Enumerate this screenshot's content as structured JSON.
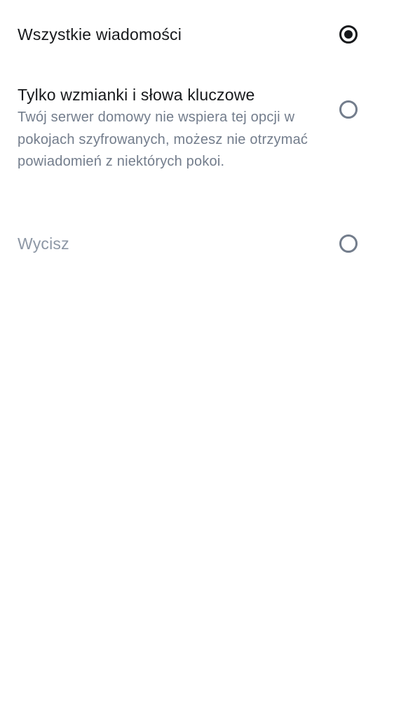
{
  "options": [
    {
      "title": "Wszystkie wiadomości",
      "selected": true,
      "enabled": true
    },
    {
      "title": "Tylko wzmianki i słowa kluczowe",
      "description": "Twój serwer domowy nie wspiera tej opcji w pokojach szyfrowanych, możesz nie otrzymać powiadomień z niektórych pokoi.",
      "selected": false,
      "enabled": true
    },
    {
      "title": "Wycisz",
      "selected": false,
      "enabled": false
    }
  ],
  "colors": {
    "primary_text": "#17191c",
    "secondary_text": "#737d8c",
    "disabled_text": "#8d97a5",
    "background": "#ffffff"
  }
}
